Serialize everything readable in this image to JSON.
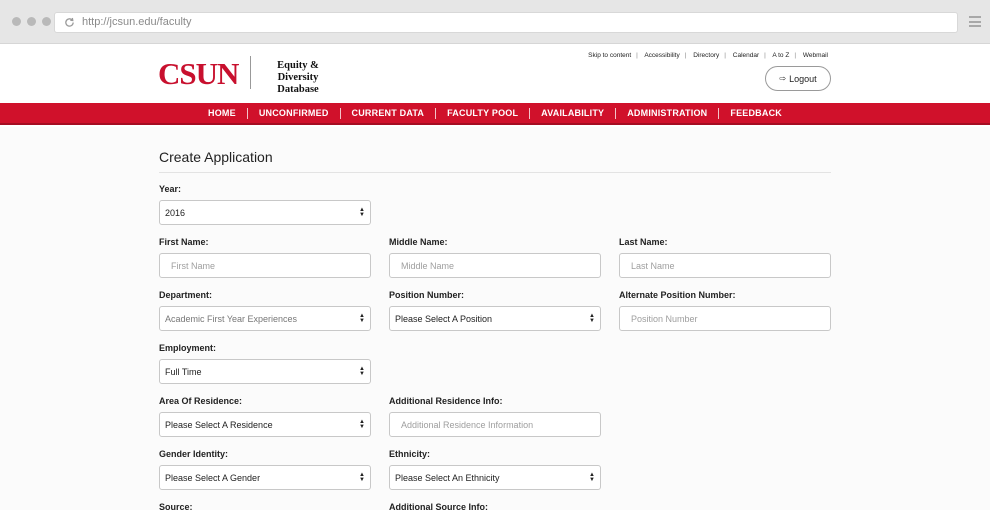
{
  "browser": {
    "url": "http://jcsun.edu/faculty"
  },
  "header": {
    "logo_text": "CSUN",
    "logo_subtitle": "Equity & Diversity Database",
    "top_links": [
      "Skip to content",
      "Accessibility",
      "Directory",
      "Calendar",
      "A to Z",
      "Webmail"
    ],
    "logout_label": "Logout"
  },
  "nav": {
    "items": [
      "HOME",
      "UNCONFIRMED",
      "CURRENT DATA",
      "FACULTY POOL",
      "AVAILABILITY",
      "ADMINISTRATION",
      "FEEDBACK"
    ]
  },
  "colors": {
    "brand_red": "#d0112b",
    "logo_red": "#c8102e"
  },
  "form": {
    "title": "Create Application",
    "year": {
      "label": "Year:",
      "value": "2016"
    },
    "first_name": {
      "label": "First Name:",
      "placeholder": "First Name"
    },
    "middle_name": {
      "label": "Middle Name:",
      "placeholder": "Middle Name"
    },
    "last_name": {
      "label": "Last Name:",
      "placeholder": "Last Name"
    },
    "department": {
      "label": "Department:",
      "value": "Academic First Year Experiences"
    },
    "position_number": {
      "label": "Position Number:",
      "value": "Please Select A Position"
    },
    "alt_position_number": {
      "label": "Alternate Position Number:",
      "placeholder": "Position Number"
    },
    "employment": {
      "label": "Employment:",
      "value": "Full Time"
    },
    "residence": {
      "label": "Area Of Residence:",
      "value": "Please Select A Residence"
    },
    "residence_info": {
      "label": "Additional Residence Info:",
      "placeholder": "Additional Residence Information"
    },
    "gender": {
      "label": "Gender Identity:",
      "value": "Please Select A Gender"
    },
    "ethnicity": {
      "label": "Ethnicity:",
      "value": "Please Select An Ethnicity"
    },
    "source": {
      "label": "Source:"
    },
    "source_info": {
      "label": "Additional Source Info:"
    }
  }
}
